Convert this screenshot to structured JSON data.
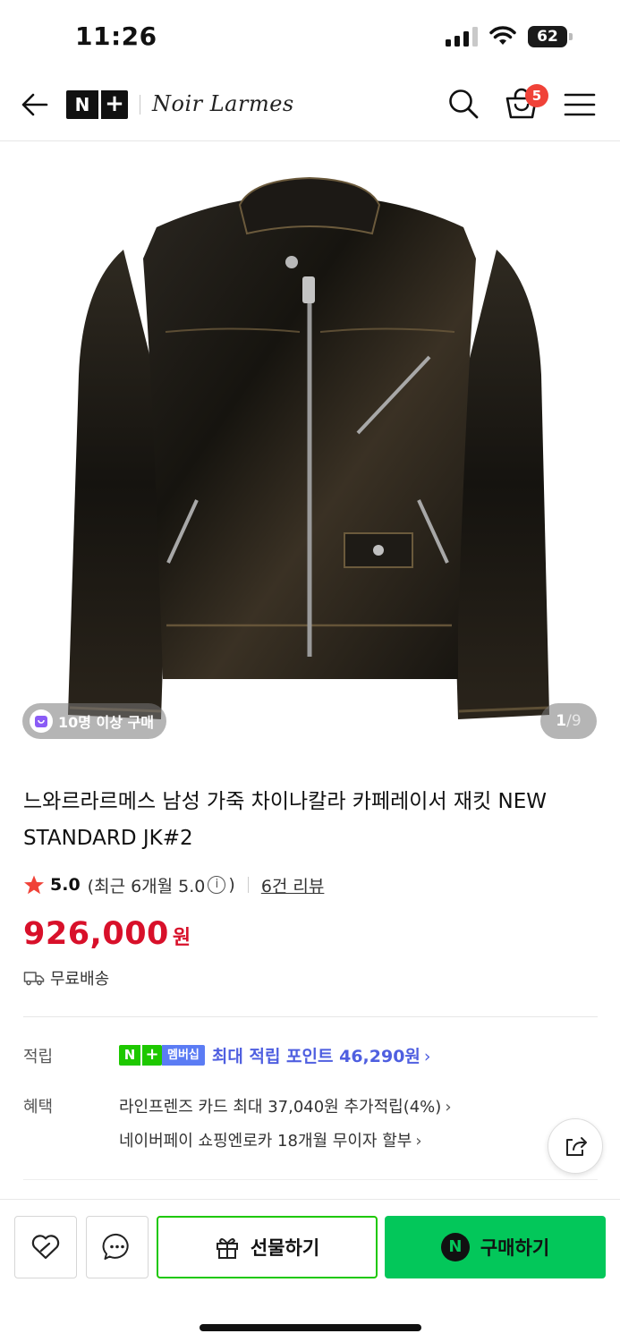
{
  "status_bar": {
    "time": "11:26",
    "battery": "62"
  },
  "header": {
    "logo_n": "N",
    "logo_plus": "+",
    "brand": "Noir Larmes",
    "cart_count": "5",
    "icons": [
      "back-arrow-icon",
      "search-icon",
      "shopping-bag-icon",
      "hamburger-menu-icon"
    ]
  },
  "gallery": {
    "buyer_badge": "10명 이상 구매",
    "current_index": "1",
    "separator": "/",
    "total": "9"
  },
  "product": {
    "title": "느와르라르메스 남성 가죽 차이나칼라 카페레이서 재킷 NEW STANDARD JK#2",
    "rating": "5.0",
    "recent_rating_prefix": "(최근 6개월 5.0",
    "info_icon": "i",
    "recent_rating_suffix": ")",
    "review_link": "6건 리뷰",
    "price": "926,000",
    "currency": "원",
    "shipping": "무료배송"
  },
  "benefits": {
    "points_label": "적립",
    "nplus_n": "N",
    "nplus_plus": "+",
    "membership_tag": "멤버십",
    "points_text": "최대 적립 포인트 46,290원",
    "benefit_label": "혜택",
    "card_benefit": "라인프렌즈 카드 최대 37,040원 추가적립(4%)",
    "installment_benefit": "네이버페이 쇼핑엔로카 18개월 무이자 할부",
    "chevron": "›"
  },
  "actions": {
    "gift_label": "선물하기",
    "buy_label": "구매하기",
    "npay_symbol": "N"
  },
  "colors": {
    "price_red": "#d8102a",
    "naver_green": "#03c75a",
    "nplus_green": "#1ec800",
    "points_blue": "#4f5fe0",
    "badge_red": "#f04238"
  }
}
